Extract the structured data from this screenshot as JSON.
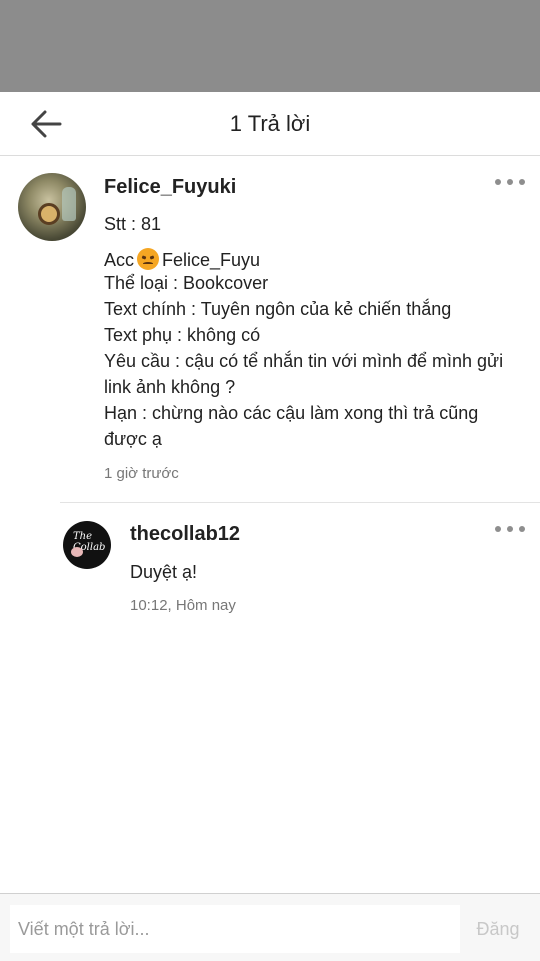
{
  "header": {
    "title": "1 Trả lời",
    "back_icon": "arrow-left-icon"
  },
  "comment": {
    "username": "Felice_Fuyuki",
    "lines": {
      "stt": "Stt : 81",
      "acc_prefix": "Acc",
      "acc_name": "Felice_Fuyu",
      "genre": "Thể loại : Bookcover",
      "main_text": "Text chính : Tuyên ngôn của kẻ chiến thắng",
      "sub_text": "Text phụ : không có",
      "request_1": "Yêu cầu : cậu có tể nhắn tin với mình để mình gửi",
      "request_2": "link ảnh không ?",
      "deadline_1": "Hạn : chừng nào các cậu làm xong thì trả cũng",
      "deadline_2": "được ạ"
    },
    "emoji": "angry-face-emoji",
    "timestamp": "1 giờ trước"
  },
  "reply": {
    "username": "thecollab12",
    "text": "Duyệt ạ!",
    "timestamp": "10:12, Hôm nay",
    "avatar_text": "The Collab"
  },
  "footer": {
    "input_placeholder": "Viết một trả lời...",
    "post_label": "Đăng"
  },
  "colors": {
    "top_bar": "#8c8c8c",
    "text": "#222222",
    "meta": "#777777",
    "post_disabled": "#c8c8c8"
  }
}
